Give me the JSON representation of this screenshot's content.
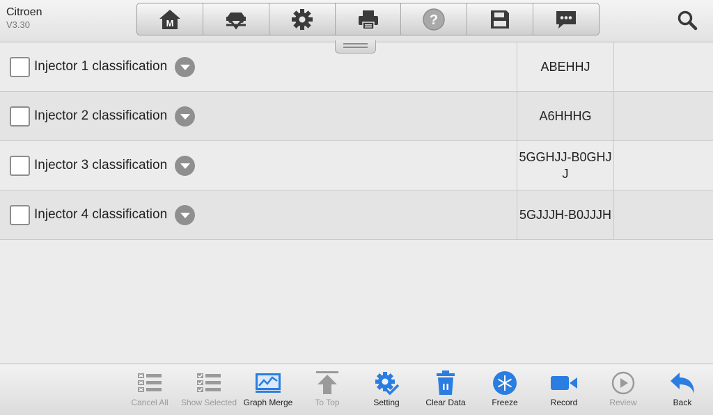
{
  "app": {
    "name": "Citroen",
    "version": "V3.30"
  },
  "toolbar": [
    {
      "icon": "home-icon",
      "letter": "M"
    },
    {
      "icon": "vehicle-icon"
    },
    {
      "icon": "gear-icon"
    },
    {
      "icon": "printer-icon"
    },
    {
      "icon": "help-icon",
      "disabled": true
    },
    {
      "icon": "save-icon"
    },
    {
      "icon": "message-icon"
    }
  ],
  "search_icon": "search-icon",
  "rows": [
    {
      "label": "Injector 1 classification",
      "value": "ABEHHJ"
    },
    {
      "label": "Injector 2 classification",
      "value": "A6HHHG"
    },
    {
      "label": "Injector 3 classification",
      "value": "5GGHJJ-B0GHJJ"
    },
    {
      "label": "Injector 4 classification",
      "value": "5GJJJH-B0JJJH"
    }
  ],
  "bottom_bar": [
    {
      "label": "Cancel All",
      "icon": "cancel-all-icon",
      "enabled": false
    },
    {
      "label": "Show Selected",
      "icon": "show-selected-icon",
      "enabled": false
    },
    {
      "label": "Graph Merge",
      "icon": "graph-merge-icon",
      "enabled": true
    },
    {
      "label": "To Top",
      "icon": "to-top-icon",
      "enabled": false
    },
    {
      "label": "Setting",
      "icon": "setting-icon",
      "enabled": true
    },
    {
      "label": "Clear Data",
      "icon": "clear-data-icon",
      "enabled": true
    },
    {
      "label": "Freeze",
      "icon": "freeze-icon",
      "enabled": true
    },
    {
      "label": "Record",
      "icon": "record-icon",
      "enabled": true
    },
    {
      "label": "Review",
      "icon": "review-icon",
      "enabled": false
    },
    {
      "label": "Back",
      "icon": "back-icon",
      "enabled": true
    }
  ],
  "colors": {
    "accent_blue": "#2a7de1",
    "disabled_gray": "#9a9a9a",
    "icon_dark": "#3a3a3a"
  }
}
